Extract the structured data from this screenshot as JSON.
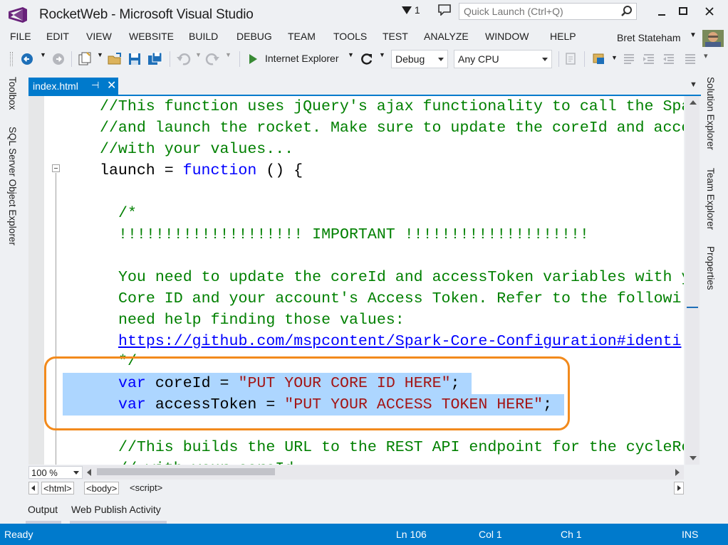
{
  "window": {
    "title": "RocketWeb - Microsoft Visual Studio",
    "notification_count": "1",
    "quick_launch_placeholder": "Quick Launch (Ctrl+Q)"
  },
  "menu": {
    "items": [
      "FILE",
      "EDIT",
      "VIEW",
      "WEBSITE",
      "BUILD",
      "DEBUG",
      "TEAM",
      "TOOLS",
      "TEST",
      "ANALYZE",
      "WINDOW",
      "HELP"
    ],
    "user_name": "Bret Stateham"
  },
  "toolbar": {
    "run_target": "Internet Explorer",
    "configuration": "Debug",
    "platform": "Any CPU"
  },
  "side_panels": {
    "left": [
      "Toolbox",
      "SQL Server Object Explorer"
    ],
    "right": [
      "Solution Explorer",
      "Team Explorer",
      "Properties"
    ]
  },
  "document": {
    "tab_name": "index.html",
    "zoom": "100 %",
    "breadcrumbs": [
      "<html>",
      "<body>",
      "<script>"
    ]
  },
  "code": {
    "line1": "//This function uses jQuery's ajax functionality to call the Spa",
    "line2": "//and launch the rocket. Make sure to update the coreId and acce",
    "line3": "//with your values...",
    "line4_ident": "launch = ",
    "line4_kw": "function",
    "line4_rest": " () {",
    "line5": "/*",
    "line6": "!!!!!!!!!!!!!!!!!!!! IMPORTANT !!!!!!!!!!!!!!!!!!!!",
    "line7": "You need to update the coreId and accessToken variables with y",
    "line8": "Core ID and your account's Access Token. Refer to the followi",
    "line9": "need help finding those values:",
    "line10_link": "https://github.com/mspcontent/Spark-Core-Configuration#identi",
    "line11": "*/",
    "line12_kw": "var",
    "line12_ident": " coreId = ",
    "line12_str": "\"PUT YOUR CORE ID HERE\"",
    "line12_end": ";",
    "line13_kw": "var",
    "line13_ident": " accessToken = ",
    "line13_str": "\"PUT YOUR ACCESS TOKEN HERE\"",
    "line13_end": ";",
    "line14": "//This builds the URL to the REST API endpoint for the cycleRo",
    "line15": "// with your coreId"
  },
  "bottom_tabs": [
    "Output",
    "Web Publish Activity"
  ],
  "status": {
    "state": "Ready",
    "line": "Ln 106",
    "col": "Col 1",
    "ch": "Ch 1",
    "mode": "INS"
  },
  "colors": {
    "accent": "#007acc",
    "comment": "#008000",
    "keyword": "#0000ff",
    "string": "#a31515",
    "selection": "#add6ff",
    "callout": "#f28a1c"
  }
}
